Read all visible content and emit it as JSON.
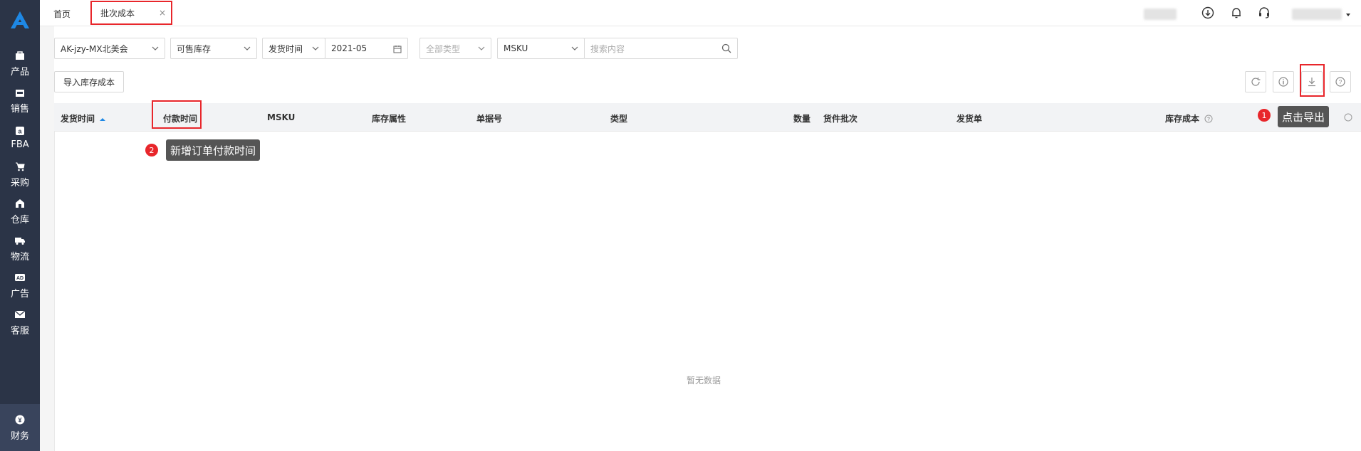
{
  "sidebar": {
    "items": [
      {
        "label": "产品",
        "icon": "bag-icon"
      },
      {
        "label": "销售",
        "icon": "shop-icon"
      },
      {
        "label": "FBA",
        "icon": "amazon-icon"
      },
      {
        "label": "采购",
        "icon": "cart-icon"
      },
      {
        "label": "仓库",
        "icon": "warehouse-icon"
      },
      {
        "label": "物流",
        "icon": "truck-icon"
      },
      {
        "label": "广告",
        "icon": "ad-icon"
      },
      {
        "label": "客服",
        "icon": "mail-icon"
      },
      {
        "label": "财务",
        "icon": "yen-icon",
        "active": true
      }
    ]
  },
  "tabs": {
    "home": "首页",
    "active": "批次成本",
    "close": "×"
  },
  "filters": {
    "store": "AK-jzy-MX北美会",
    "stock": "可售库存",
    "time_type": "发货时间",
    "month": "2021-05",
    "category_placeholder": "全部类型",
    "sku_type": "MSKU",
    "search_placeholder": "搜索内容"
  },
  "toolbar": {
    "import_label": "导入库存成本"
  },
  "table": {
    "columns": [
      "发货时间",
      "付款时间",
      "MSKU",
      "库存属性",
      "单据号",
      "类型",
      "数量",
      "货件批次",
      "发货单",
      "库存成本"
    ],
    "empty_text": "暂无数据"
  },
  "annotations": {
    "tip1_num": "1",
    "tip1_text": "点击导出",
    "tip2_num": "2",
    "tip2_text": "新增订单付款时间"
  },
  "colors": {
    "sidebar": "#2b3447",
    "accent_red": "#e8262b",
    "brand_blue": "#1e88e5"
  }
}
